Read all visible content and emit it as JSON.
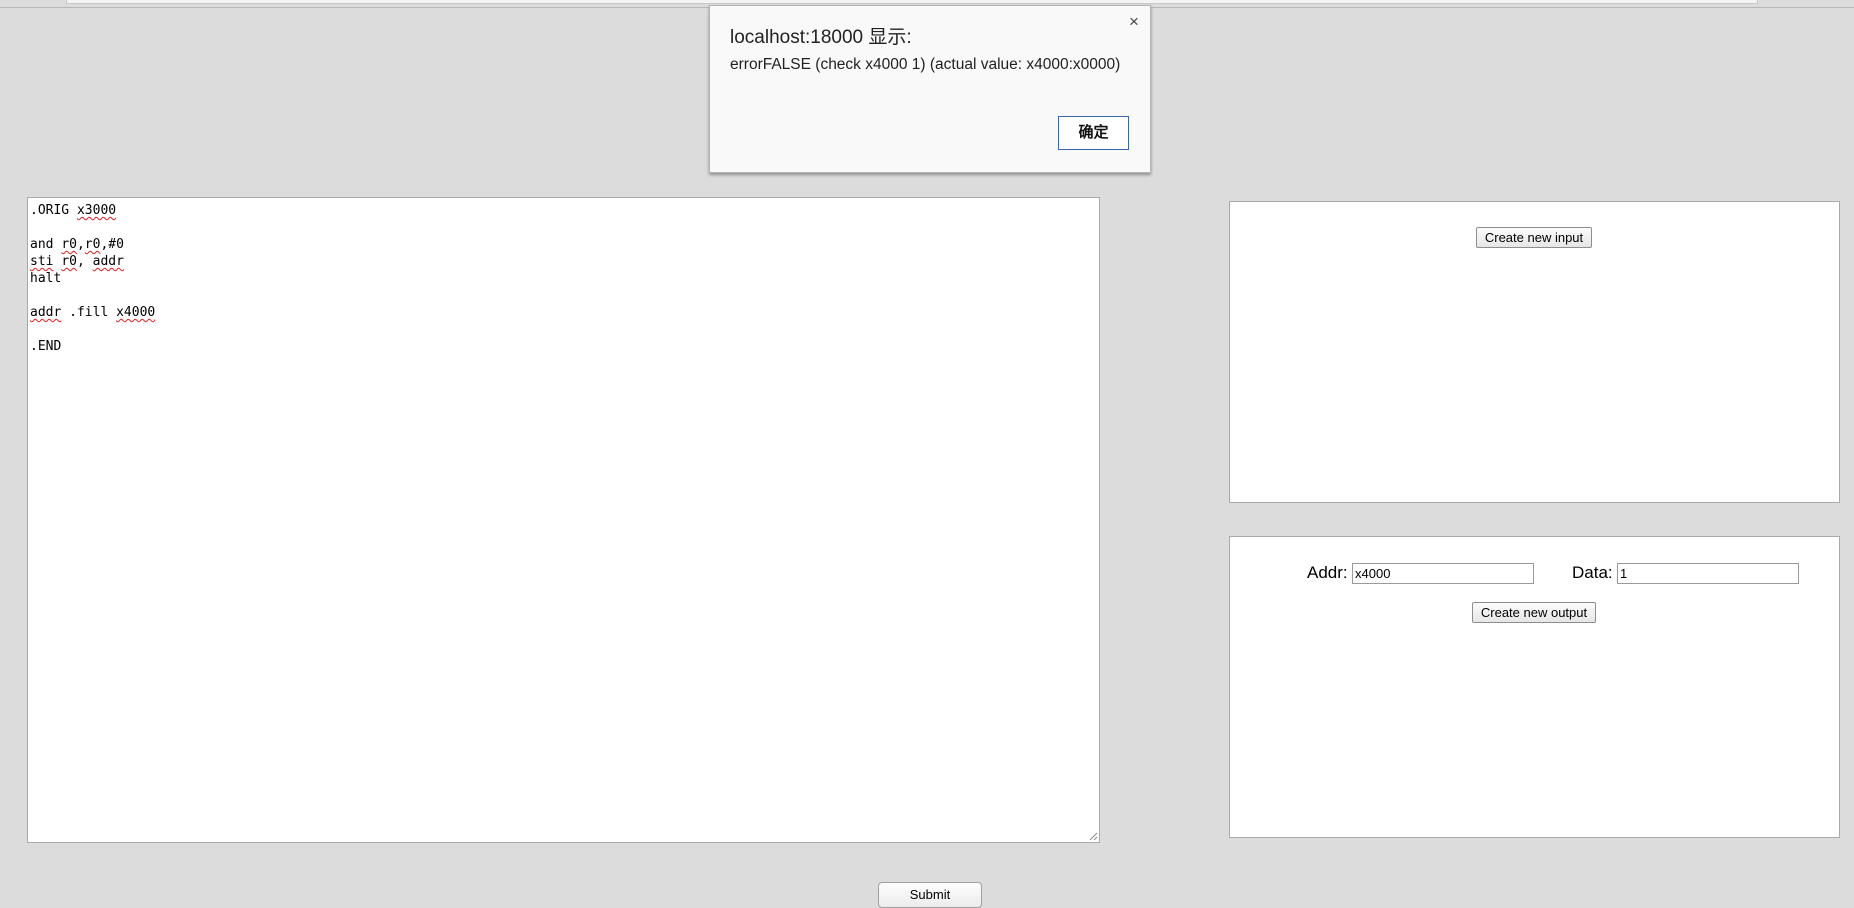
{
  "editor": {
    "lines": [
      [
        {
          "t": ".ORIG "
        },
        {
          "t": "x3000",
          "sq": true
        }
      ],
      [],
      [
        {
          "t": "and "
        },
        {
          "t": "r0",
          "sq": true
        },
        {
          "t": ","
        },
        {
          "t": "r0",
          "sq": true
        },
        {
          "t": ",#0"
        }
      ],
      [
        {
          "t": "sti",
          "sq": true
        },
        {
          "t": " "
        },
        {
          "t": "r0",
          "sq": true
        },
        {
          "t": ", "
        },
        {
          "t": "addr",
          "sq": true
        }
      ],
      [
        {
          "t": "halt"
        }
      ],
      [],
      [
        {
          "t": "addr",
          "sq": true
        },
        {
          "t": " .fill "
        },
        {
          "t": "x4000",
          "sq": true
        }
      ],
      [],
      [
        {
          "t": ".END"
        }
      ]
    ]
  },
  "input_panel": {
    "create_button_label": "Create new input"
  },
  "output_panel": {
    "addr_label": "Addr:",
    "addr_value": "x4000",
    "data_label": "Data:",
    "data_value": "1",
    "create_button_label": "Create new output"
  },
  "submit": {
    "label": "Submit"
  },
  "dialog": {
    "title": "localhost:18000 显示:",
    "message": "errorFALSE (check x4000 1) (actual value: x4000:x0000)",
    "ok_label": "确定",
    "close_glyph": "×"
  }
}
